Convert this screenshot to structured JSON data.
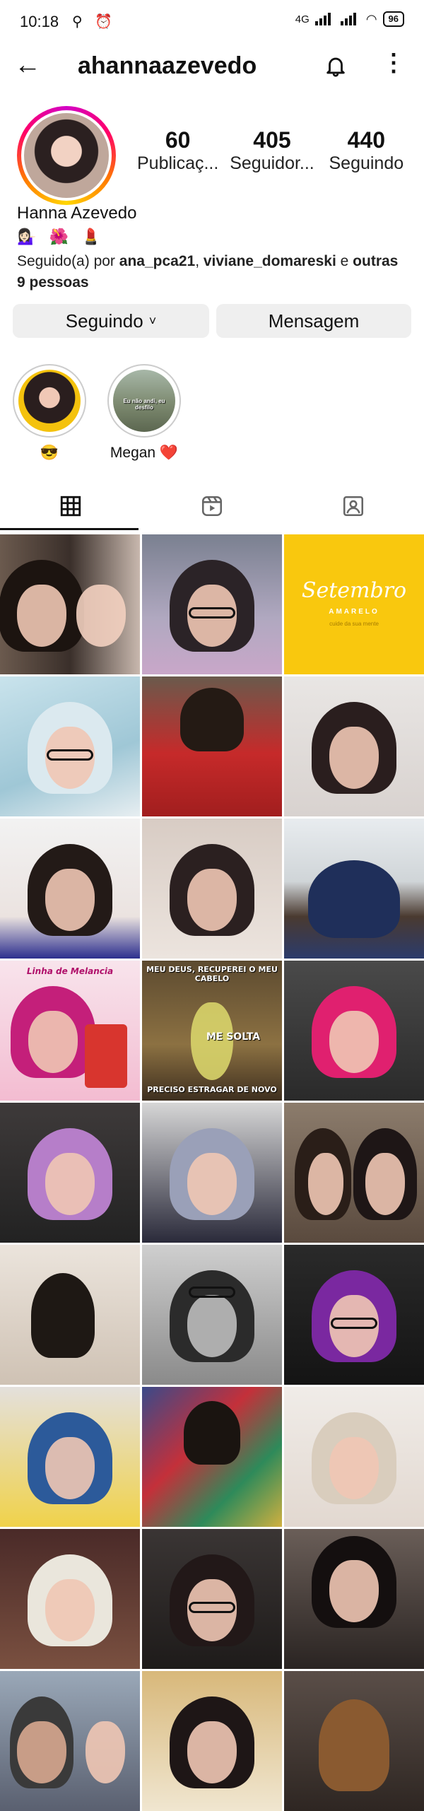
{
  "status": {
    "time": "10:18",
    "left_icons": "⚲ ⏰",
    "network": "4G",
    "battery": "96"
  },
  "header": {
    "username": "ahannaazevedo",
    "back_icon": "arrow-left-icon",
    "bell_icon": "bell-icon",
    "menu_icon": "more-vertical-icon"
  },
  "profile": {
    "posts_count": "60",
    "posts_label": "Publicaç...",
    "followers_count": "405",
    "followers_label": "Seguidor...",
    "following_count": "440",
    "following_label": "Seguindo",
    "full_name": "Hanna Azevedo",
    "bio_emojis": "💁🏻‍♀️ 🌺 💄",
    "followed_prefix": "Seguido(a) por ",
    "followed_user1": "ana_pca21",
    "followed_sep": ", ",
    "followed_user2": "viviane_domareski",
    "followed_and": " e ",
    "followed_others": "outras 9 pessoas"
  },
  "buttons": {
    "following_label": "Seguindo",
    "following_caret": "˅",
    "message_label": "Mensagem"
  },
  "highlights": [
    {
      "label": "😎"
    },
    {
      "label": "Megan ❤️",
      "overlay_text": "Eu não andi, eu desfilo"
    }
  ],
  "tabs": [
    {
      "name": "grid-icon",
      "active": true
    },
    {
      "name": "reels-icon",
      "active": false
    },
    {
      "name": "tagged-icon",
      "active": false
    }
  ],
  "posts": {
    "setembro_title": "Setembro",
    "setembro_sub": "AMARELO",
    "setembro_sub2": "cuide da sua mente",
    "promo_caption": "Linha de Melancia",
    "meme_top": "MEU DEUS, RECUPEREI O MEU CABELO",
    "meme_mid": "ME SOLTA",
    "meme_bottom": "PRECISO ESTRAGAR DE NOVO"
  },
  "colors": {
    "accent_yellow": "#f9c80e",
    "button_bg": "#efefef",
    "heart": "#e0245e"
  }
}
